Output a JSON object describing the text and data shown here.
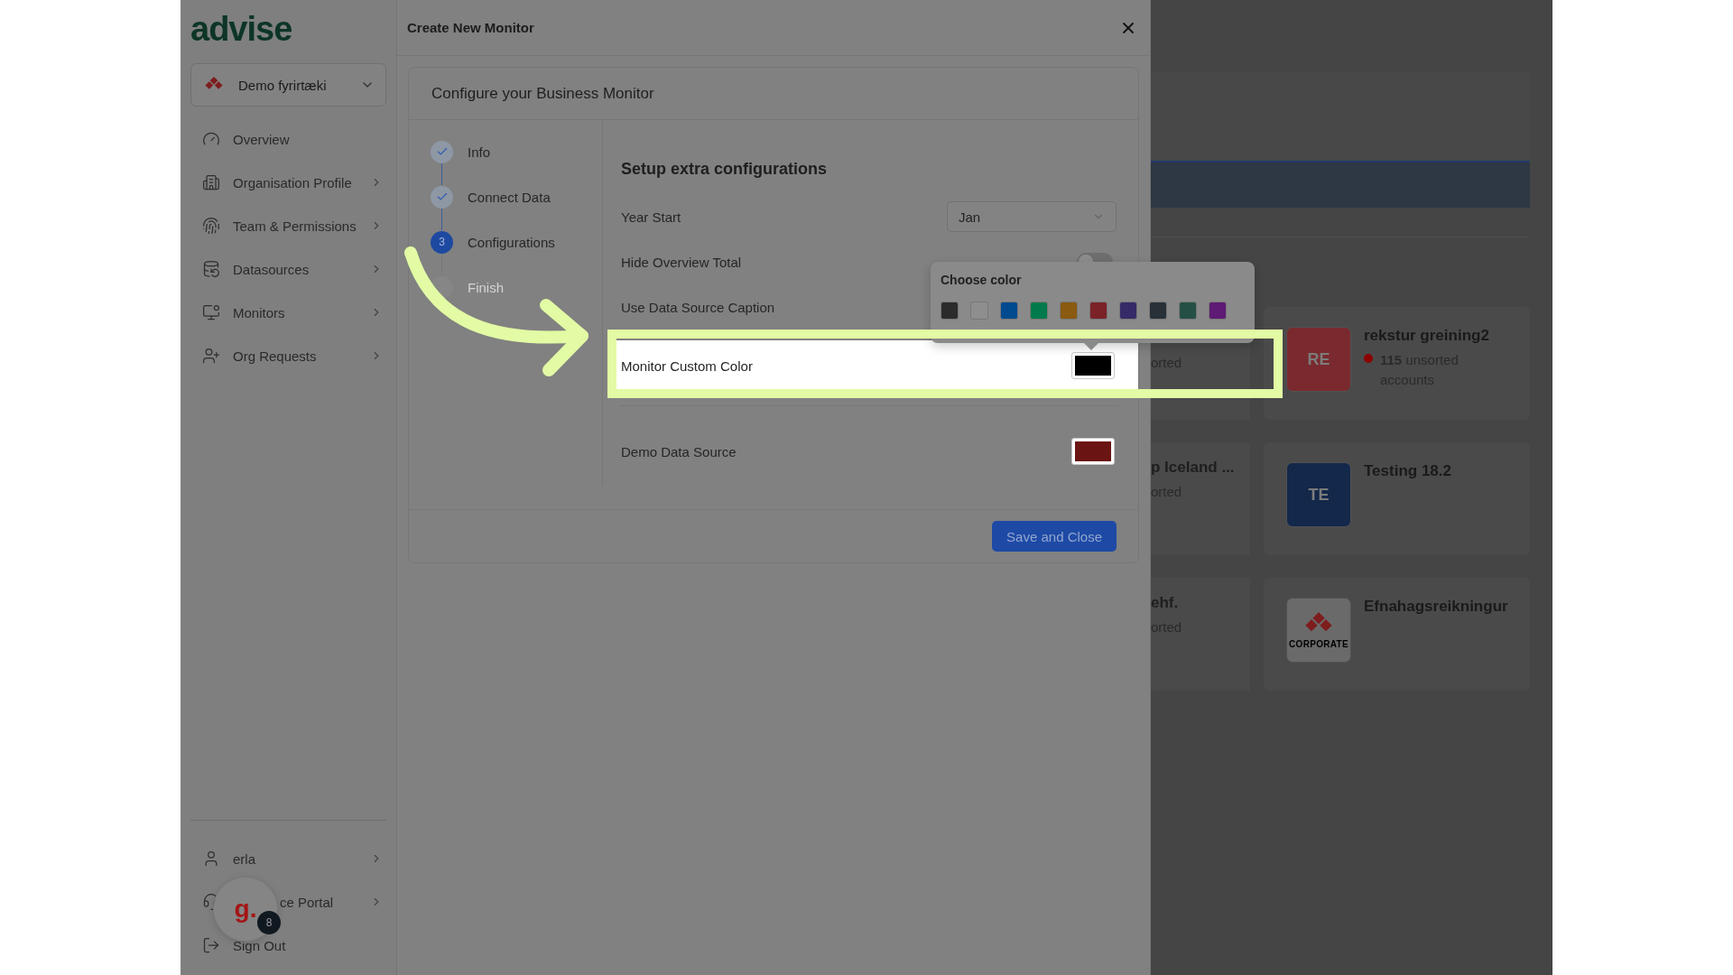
{
  "sidebar": {
    "logo": "advise",
    "company": {
      "name": "Demo fyrirtæki"
    },
    "nav": [
      {
        "label": "Overview"
      },
      {
        "label": "Organisation Profile",
        "expandable": true
      },
      {
        "label": "Team & Permissions",
        "expandable": true
      },
      {
        "label": "Datasources",
        "expandable": true
      },
      {
        "label": "Monitors",
        "expandable": true
      },
      {
        "label": "Org Requests",
        "expandable": true
      }
    ],
    "footer": [
      {
        "label": "erla",
        "expandable": true,
        "kind": "full"
      },
      {
        "label": "ce Portal",
        "expandable": true,
        "kind": "covered"
      },
      {
        "label": "Sign Out",
        "kind": "full"
      }
    ]
  },
  "chat_bubble": {
    "label": "g.",
    "badge": "8"
  },
  "modal": {
    "title": "Create New Monitor",
    "card_title": "Configure your Business Monitor",
    "steps": [
      {
        "label": "Info",
        "done": true,
        "selected": false
      },
      {
        "label": "Connect Data",
        "done": true,
        "selected": false
      },
      {
        "label": "Configurations",
        "done": false,
        "selected": true,
        "number": "3"
      },
      {
        "label": "Finish",
        "done": false,
        "selected": false
      }
    ],
    "section_title": "Setup extra configurations",
    "rows": [
      {
        "kind": "select",
        "label": "Year Start",
        "value": "Jan"
      },
      {
        "kind": "toggle",
        "label": "Hide Overview Total",
        "on": false
      },
      {
        "kind": "label",
        "label": "Use Data Source Caption"
      },
      {
        "kind": "color",
        "label": "Monitor Custom Color",
        "color": "#000000",
        "highlighted": true,
        "popover": {
          "title": "Choose color",
          "swatches": [
            {
              "color": "#2b2b2b"
            },
            {
              "color": "#8e8e8e"
            },
            {
              "color": "#004a8f"
            },
            {
              "color": "#007a4a"
            },
            {
              "color": "#8a5a10"
            },
            {
              "color": "#7a2228"
            },
            {
              "color": "#372a68"
            },
            {
              "color": "#283138"
            },
            {
              "color": "#244f45"
            },
            {
              "color": "#5e1a74"
            }
          ]
        }
      },
      {
        "kind": "color",
        "label": "Demo Data Source",
        "color": "#6b1414",
        "highlighted": false
      }
    ],
    "save_button": "Save and Close"
  },
  "monitors": {
    "left_column": [
      {
        "subtitle": "orted"
      },
      {
        "title": "p Iceland ...",
        "subtitle": "orted"
      },
      {
        "title": "ehf.",
        "subtitle": "orted"
      }
    ],
    "right_column": [
      {
        "tile": {
          "kind": "initials",
          "text": "RE",
          "color": "#7a2a2e"
        },
        "title": "rekstur greining2",
        "status": {
          "color": "#8b0000",
          "text": "**115** unsorted accounts"
        }
      },
      {
        "tile": {
          "kind": "initials",
          "text": "TE",
          "color": "#13284a"
        },
        "title": "Testing 18.2"
      },
      {
        "tile": {
          "kind": "logo",
          "text": "CORPORATE"
        },
        "title": "Efnahagsreikningur"
      }
    ]
  }
}
